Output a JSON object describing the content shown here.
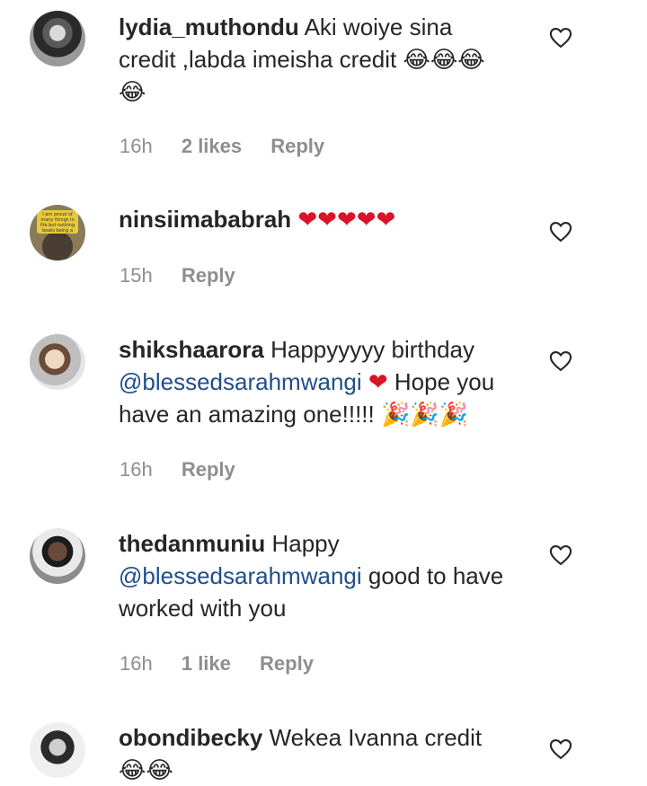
{
  "comments": [
    {
      "username": "lydia_muthondu",
      "text": "Aki woiye sina credit ,labda imeisha credit 😂😂😂 😂",
      "time": "16h",
      "likes": "2 likes",
      "reply": "Reply"
    },
    {
      "username": "ninsiimababrah",
      "text": "❤❤❤❤❤",
      "time": "15h",
      "likes": "",
      "reply": "Reply",
      "avatar_sign": "I am proud of many things in life but nothing beats being a mother"
    },
    {
      "username": "shikshaarora",
      "text_before": "Happyyyyy birthday",
      "mention": "@blessedsarahmwangi",
      "heart": "❤",
      "text_after": "Hope you have an amazing one!!!!! 🎉🎉🎉",
      "time": "16h",
      "likes": "",
      "reply": "Reply"
    },
    {
      "username": "thedanmuniu",
      "text_before": "Happy",
      "mention": "@blessedsarahmwangi",
      "text_after": "good to have worked with you",
      "time": "16h",
      "likes": "1 like",
      "reply": "Reply"
    },
    {
      "username": "obondibecky",
      "text": "Wekea Ivanna credit 😂😂",
      "time": "",
      "likes": "",
      "reply": ""
    }
  ],
  "colors": {
    "text": "#262626",
    "meta": "#8e8e8e",
    "mention": "#1f4e8a",
    "heart": "#d9142a"
  },
  "icons": {
    "like": "heart-outline-icon"
  }
}
